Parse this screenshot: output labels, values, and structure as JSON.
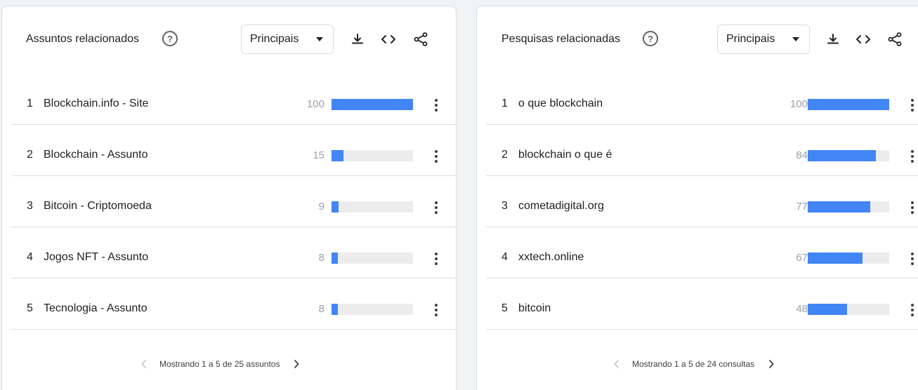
{
  "colors": {
    "bar": "#4285f4",
    "track": "#ececec",
    "background": "#f1f3f4"
  },
  "left_panel": {
    "title": "Assuntos relacionados",
    "help_icon": "help-circle-icon",
    "dropdown": {
      "selected": "Principais",
      "icon": "caret-down-icon"
    },
    "tools": [
      "download-icon",
      "embed-code-icon",
      "share-icon"
    ],
    "rows": [
      {
        "rank": "1",
        "label": "Blockchain.info - Site",
        "value": "100",
        "fraction": 1.0
      },
      {
        "rank": "2",
        "label": "Blockchain - Assunto",
        "value": "15",
        "fraction": 0.15
      },
      {
        "rank": "3",
        "label": "Bitcoin - Criptomoeda",
        "value": "9",
        "fraction": 0.09
      },
      {
        "rank": "4",
        "label": "Jogos NFT - Assunto",
        "value": "8",
        "fraction": 0.08
      },
      {
        "rank": "5",
        "label": "Tecnologia - Assunto",
        "value": "8",
        "fraction": 0.08
      }
    ],
    "footer": {
      "text": "Mostrando 1 a 5 de 25 assuntos",
      "prev_enabled": false,
      "next_enabled": true
    }
  },
  "right_panel": {
    "title": "Pesquisas relacionadas",
    "help_icon": "help-circle-icon",
    "dropdown": {
      "selected": "Principais",
      "icon": "caret-down-icon"
    },
    "tools": [
      "download-icon",
      "embed-code-icon",
      "share-icon"
    ],
    "rows": [
      {
        "rank": "1",
        "label": "o que blockchain",
        "value": "100",
        "fraction": 1.0
      },
      {
        "rank": "2",
        "label": "blockchain o que é",
        "value": "84",
        "fraction": 0.84
      },
      {
        "rank": "3",
        "label": "cometadigital.org",
        "value": "77",
        "fraction": 0.77
      },
      {
        "rank": "4",
        "label": "xxtech.online",
        "value": "67",
        "fraction": 0.67
      },
      {
        "rank": "5",
        "label": "bitcoin",
        "value": "48",
        "fraction": 0.48
      }
    ],
    "footer": {
      "text": "Mostrando 1 a 5 de 24 consultas",
      "prev_enabled": false,
      "next_enabled": true
    }
  }
}
